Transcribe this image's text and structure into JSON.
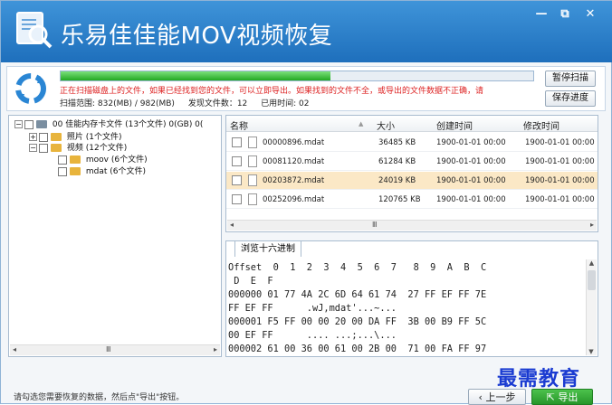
{
  "app": {
    "title": "乐易佳佳能MOV视频恢复"
  },
  "window_controls": {
    "minimize": "—",
    "restore": "⧉",
    "close": "✕"
  },
  "scan": {
    "progress_fraction": 0.57,
    "warning": "正在扫描磁盘上的文件，如果已经找到您的文件，可以立即导出。如果找到的文件不全，或导出的文件数据不正确，请",
    "range_label": "扫描范围: 832(MB) / 982(MB)",
    "found_label": "发现文件数：12",
    "time_label": "已用时间: 02",
    "pause_button": "暂停扫描",
    "save_button": "保存进度"
  },
  "tree": {
    "root": {
      "label": "佳能内存卡文件",
      "info": "(13个文件) 0(GB) 0(",
      "prefix": "00"
    },
    "nodes": [
      {
        "label": "照片",
        "info": "(1个文件)"
      },
      {
        "label": "视频",
        "info": "(12个文件)"
      },
      {
        "label": "moov",
        "info": "(6个文件)"
      },
      {
        "label": "mdat",
        "info": "(6个文件)"
      }
    ],
    "scroll_label": "Ⅲ"
  },
  "files": {
    "columns": [
      "名称",
      "大小",
      "创建时间",
      "修改时间"
    ],
    "rows": [
      {
        "name": "00000896.mdat",
        "size": "36485 KB",
        "created": "1900-01-01 00:00",
        "modified": "1900-01-01 00:00"
      },
      {
        "name": "00081120.mdat",
        "size": "61284 KB",
        "created": "1900-01-01 00:00",
        "modified": "1900-01-01 00:00"
      },
      {
        "name": "00203872.mdat",
        "size": "24019 KB",
        "created": "1900-01-01 00:00",
        "modified": "1900-01-01 00:00"
      },
      {
        "name": "00252096.mdat",
        "size": "120765 KB",
        "created": "1900-01-01 00:00",
        "modified": "1900-01-01 00:00"
      }
    ],
    "selected_index": 2,
    "scroll_label": "Ⅲ"
  },
  "hex": {
    "tab": "浏览十六进制",
    "lines": [
      "Offset  0  1  2  3  4  5  6  7   8  9  A  B  C",
      " D  E  F",
      "000000 01 77 4A 2C 6D 64 61 74  27 FF EF FF 7E",
      "FF EF FF      .wJ,mdat'...~...",
      "000001 F5 FF 00 00 20 00 DA FF  3B 00 B9 FF 5C",
      "00 EF FF      .... ...;...\\...",
      "000002 61 00 36 00 61 00 2B 00  71 00 FA FF 97"
    ]
  },
  "footer": {
    "status": "请勾选您需要恢复的数据，然后点\"导出\"按钮。",
    "back_button": "上一步",
    "export_button": "导出"
  },
  "watermark": "最需教育",
  "colors": {
    "title_bar": "#2b7fcc",
    "warning": "#dd2222",
    "progress": "#2fb52f",
    "selected_row": "#fbe8c6"
  }
}
